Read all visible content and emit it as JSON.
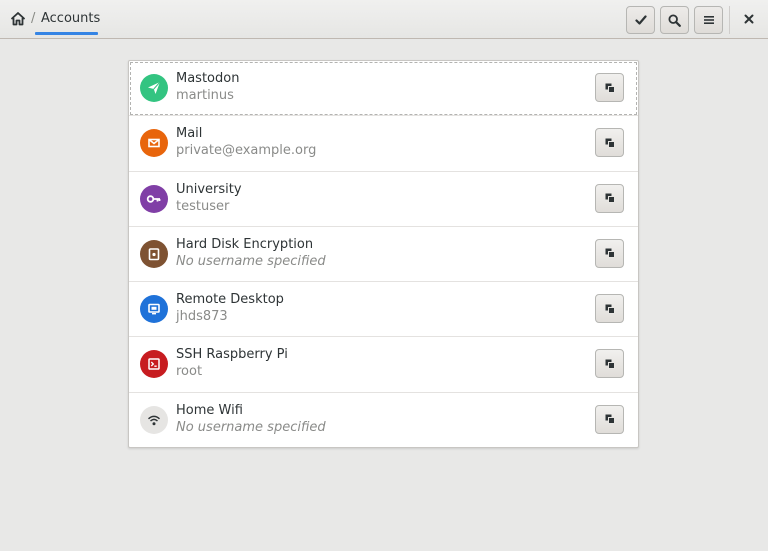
{
  "header": {
    "breadcrumb_separator": "/",
    "breadcrumb_current": "Accounts",
    "accent_color": "#3584e4"
  },
  "accounts": [
    {
      "title": "Mastodon",
      "subtitle": "martinus",
      "color": "#33c481",
      "icon": "paper-plane-icon"
    },
    {
      "title": "Mail",
      "subtitle": "private@example.org",
      "color": "#e8650c",
      "icon": "envelope-icon"
    },
    {
      "title": "University",
      "subtitle": "testuser",
      "color": "#803fa6",
      "icon": "key-icon"
    },
    {
      "title": "Hard Disk Encryption",
      "subtitle": "No username specified",
      "color": "#7e5232",
      "icon": "lock-icon"
    },
    {
      "title": "Remote Desktop",
      "subtitle": "jhds873",
      "color": "#1f72d9",
      "icon": "monitor-icon"
    },
    {
      "title": "SSH Raspberry Pi",
      "subtitle": "root",
      "color": "#c71c20",
      "icon": "terminal-icon"
    },
    {
      "title": "Home Wifi",
      "subtitle": "No username specified",
      "color": "#e6e5e3",
      "icon": "wifi-icon"
    }
  ]
}
